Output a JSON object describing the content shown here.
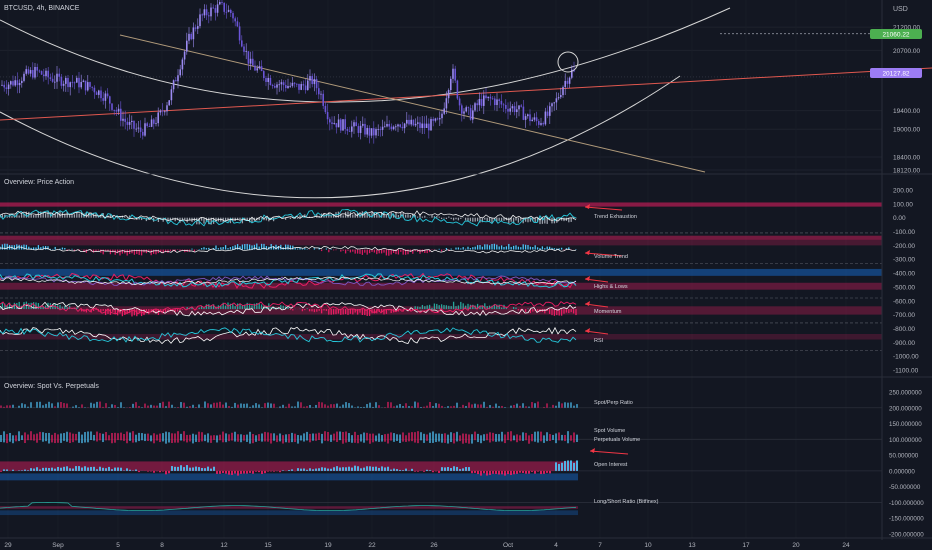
{
  "header": {
    "symbol": "BTCUSD, 4h, BINANCE",
    "currency": "USD"
  },
  "price_badges": {
    "level": "21060.22",
    "last": "20127.82"
  },
  "panel2": {
    "title": "Overview: Price Action",
    "labels": [
      "Trend Exhaustion",
      "Volume Trend",
      "Highs & Lows",
      "Momentum",
      "RSI"
    ]
  },
  "panel3": {
    "title": "Overview: Spot Vs. Perpetuals",
    "labels": [
      "Spot/Perp Ratio",
      "Spot Volume",
      "Perpetuals Volume",
      "Open Interest",
      "Long/Short Ratio (Bitfinex)"
    ]
  },
  "time_axis": [
    "29",
    "Sep",
    "5",
    "8",
    "12",
    "15",
    "19",
    "22",
    "26",
    "Oct",
    "4",
    "7",
    "10",
    "13",
    "17",
    "20",
    "24"
  ],
  "colors": {
    "bg": "#131722",
    "up": "#7b5cf0",
    "accent_red": "#f23645",
    "accent_teal": "#26c6da",
    "pink": "#e91e63",
    "badge_green": "#4caf50",
    "badge_purple": "#9c7cf4"
  },
  "chart_data": [
    {
      "type": "candlestick",
      "title": "BTCUSD, 4h, BINANCE",
      "y_ticks": [
        21200,
        20700,
        19400,
        19000,
        18400,
        18120
      ],
      "ylim": [
        18120,
        21700
      ],
      "x_ticks": [
        "29",
        "Sep",
        "5",
        "8",
        "12",
        "15",
        "19",
        "22",
        "26",
        "Oct",
        "4",
        "7",
        "10",
        "13",
        "17",
        "20",
        "24"
      ],
      "close_path": [
        [
          0,
          19950
        ],
        [
          12,
          20000
        ],
        [
          24,
          20150
        ],
        [
          36,
          20250
        ],
        [
          50,
          20100
        ],
        [
          64,
          20050
        ],
        [
          78,
          20000
        ],
        [
          92,
          19900
        ],
        [
          106,
          19700
        ],
        [
          118,
          19350
        ],
        [
          128,
          19100
        ],
        [
          140,
          18950
        ],
        [
          150,
          19050
        ],
        [
          160,
          19300
        ],
        [
          170,
          19700
        ],
        [
          180,
          20400
        ],
        [
          190,
          21000
        ],
        [
          200,
          21400
        ],
        [
          210,
          21550
        ],
        [
          220,
          21650
        ],
        [
          232,
          21500
        ],
        [
          242,
          20900
        ],
        [
          250,
          20400
        ],
        [
          262,
          20200
        ],
        [
          274,
          20000
        ],
        [
          286,
          19950
        ],
        [
          300,
          19900
        ],
        [
          312,
          20050
        ],
        [
          320,
          19800
        ],
        [
          330,
          19200
        ],
        [
          340,
          19100
        ],
        [
          350,
          19050
        ],
        [
          362,
          19000
        ],
        [
          372,
          18900
        ],
        [
          384,
          19000
        ],
        [
          396,
          19150
        ],
        [
          410,
          19100
        ],
        [
          424,
          19050
        ],
        [
          440,
          19150
        ],
        [
          452,
          20300
        ],
        [
          460,
          19500
        ],
        [
          470,
          19300
        ],
        [
          480,
          19600
        ],
        [
          492,
          19650
        ],
        [
          504,
          19500
        ],
        [
          516,
          19450
        ],
        [
          528,
          19250
        ],
        [
          538,
          19150
        ],
        [
          548,
          19300
        ],
        [
          556,
          19600
        ],
        [
          564,
          20000
        ],
        [
          572,
          20250
        ],
        [
          578,
          20128
        ]
      ],
      "price_levels": [
        21060.22,
        20127.82
      ]
    },
    {
      "type": "oscillators",
      "title": "Overview: Price Action",
      "y_ticks": [
        200,
        100,
        0,
        -100,
        -200,
        -300,
        -400,
        -500,
        -600,
        -700,
        -800,
        -900,
        -1000,
        -1100
      ],
      "ylim": [
        -1100,
        200
      ],
      "series": [
        {
          "name": "Trend Exhaustion"
        },
        {
          "name": "Volume Trend"
        },
        {
          "name": "Highs & Lows"
        },
        {
          "name": "Momentum"
        },
        {
          "name": "RSI"
        }
      ]
    },
    {
      "type": "bar",
      "title": "Overview: Spot Vs. Perpetuals",
      "y_ticks": [
        250,
        200,
        150,
        100,
        50,
        0,
        -50,
        -100,
        -150,
        -200
      ],
      "y_tick_labels": [
        "250.000000",
        "200.000000",
        "150.000000",
        "100.000000",
        "50.000000",
        "0.000000",
        "-50.000000",
        "-100.000000",
        "-150.000000",
        "-200.000000"
      ],
      "ylim": [
        -200,
        250
      ],
      "series": [
        {
          "name": "Spot/Perp Ratio"
        },
        {
          "name": "Spot Volume"
        },
        {
          "name": "Perpetuals Volume"
        },
        {
          "name": "Open Interest"
        },
        {
          "name": "Long/Short Ratio (Bitfinex)"
        }
      ]
    }
  ]
}
